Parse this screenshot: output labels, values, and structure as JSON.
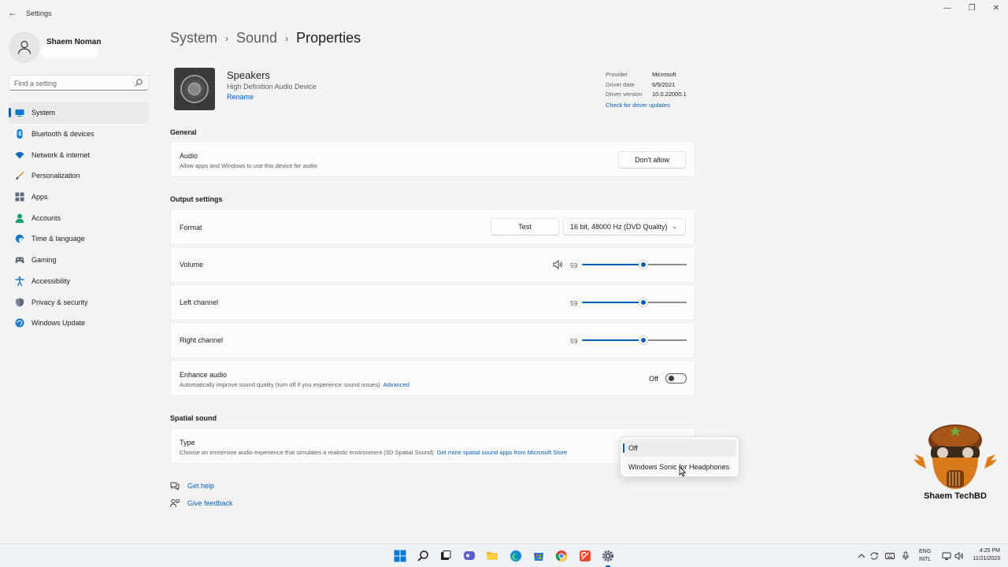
{
  "window": {
    "title": "Settings",
    "back_glyph": "←",
    "minimize_glyph": "—",
    "restore_glyph": "❐",
    "close_glyph": "✕"
  },
  "profile": {
    "name": "Shaem Noman"
  },
  "search": {
    "placeholder": "Find a setting"
  },
  "sidebar": {
    "items": [
      {
        "label": "System",
        "icon": "monitor-icon",
        "active": true
      },
      {
        "label": "Bluetooth & devices",
        "icon": "bluetooth-icon"
      },
      {
        "label": "Network & internet",
        "icon": "wifi-icon"
      },
      {
        "label": "Personalization",
        "icon": "brush-icon"
      },
      {
        "label": "Apps",
        "icon": "apps-icon"
      },
      {
        "label": "Accounts",
        "icon": "person-icon"
      },
      {
        "label": "Time & language",
        "icon": "globe-clock-icon"
      },
      {
        "label": "Gaming",
        "icon": "gamepad-icon"
      },
      {
        "label": "Accessibility",
        "icon": "accessibility-icon"
      },
      {
        "label": "Privacy & security",
        "icon": "shield-icon"
      },
      {
        "label": "Windows Update",
        "icon": "update-icon"
      }
    ]
  },
  "breadcrumb": {
    "items": [
      "System",
      "Sound",
      "Properties"
    ],
    "separator": "›"
  },
  "device": {
    "name": "Speakers",
    "description": "High Definition Audio Device",
    "rename_label": "Rename"
  },
  "driver": {
    "provider_label": "Provider",
    "provider": "Microsoft",
    "date_label": "Driver date",
    "date": "6/5/2021",
    "version_label": "Driver version",
    "version": "10.0.22000.1",
    "update_link": "Check for driver updates"
  },
  "general": {
    "title": "General",
    "audio_title": "Audio",
    "audio_sub": "Allow apps and Windows to use this device for audio",
    "audio_button": "Don't allow"
  },
  "output": {
    "title": "Output settings",
    "format_label": "Format",
    "test_button": "Test",
    "format_value": "16 bit, 48000 Hz (DVD Quality)",
    "volume_label": "Volume",
    "volume_value": "59",
    "left_label": "Left channel",
    "left_value": "59",
    "right_label": "Right channel",
    "right_value": "59",
    "enhance_title": "Enhance audio",
    "enhance_sub": "Automatically improve sound quality (turn off if you experience sound issues)",
    "enhance_link": "Advanced",
    "enhance_state": "Off"
  },
  "spatial": {
    "title": "Spatial sound",
    "type_title": "Type",
    "type_sub": "Choose an immersive audio experience that simulates a realistic environment (3D Spatial Sound)",
    "type_link": "Get more spatial sound apps from Microsoft Store",
    "options": [
      "Off",
      "Windows Sonic for Headphones"
    ],
    "selected": "Off"
  },
  "help": {
    "get_help": "Get help",
    "give_feedback": "Give feedback"
  },
  "watermark": {
    "text": "Shaem TechBD"
  },
  "taskbar": {
    "apps": [
      "start-icon",
      "search-icon",
      "task-view-icon",
      "chat-icon",
      "file-explorer-icon",
      "edge-icon",
      "store-icon",
      "chrome-icon",
      "snipping-tool-icon",
      "settings-icon"
    ],
    "lang_line1": "ENG",
    "lang_line2": "INTL",
    "time": "4:25 PM",
    "date": "11/21/2023"
  },
  "colors": {
    "accent": "#005fb8",
    "background": "#f3f3f3",
    "card": "#fbfbfb"
  }
}
